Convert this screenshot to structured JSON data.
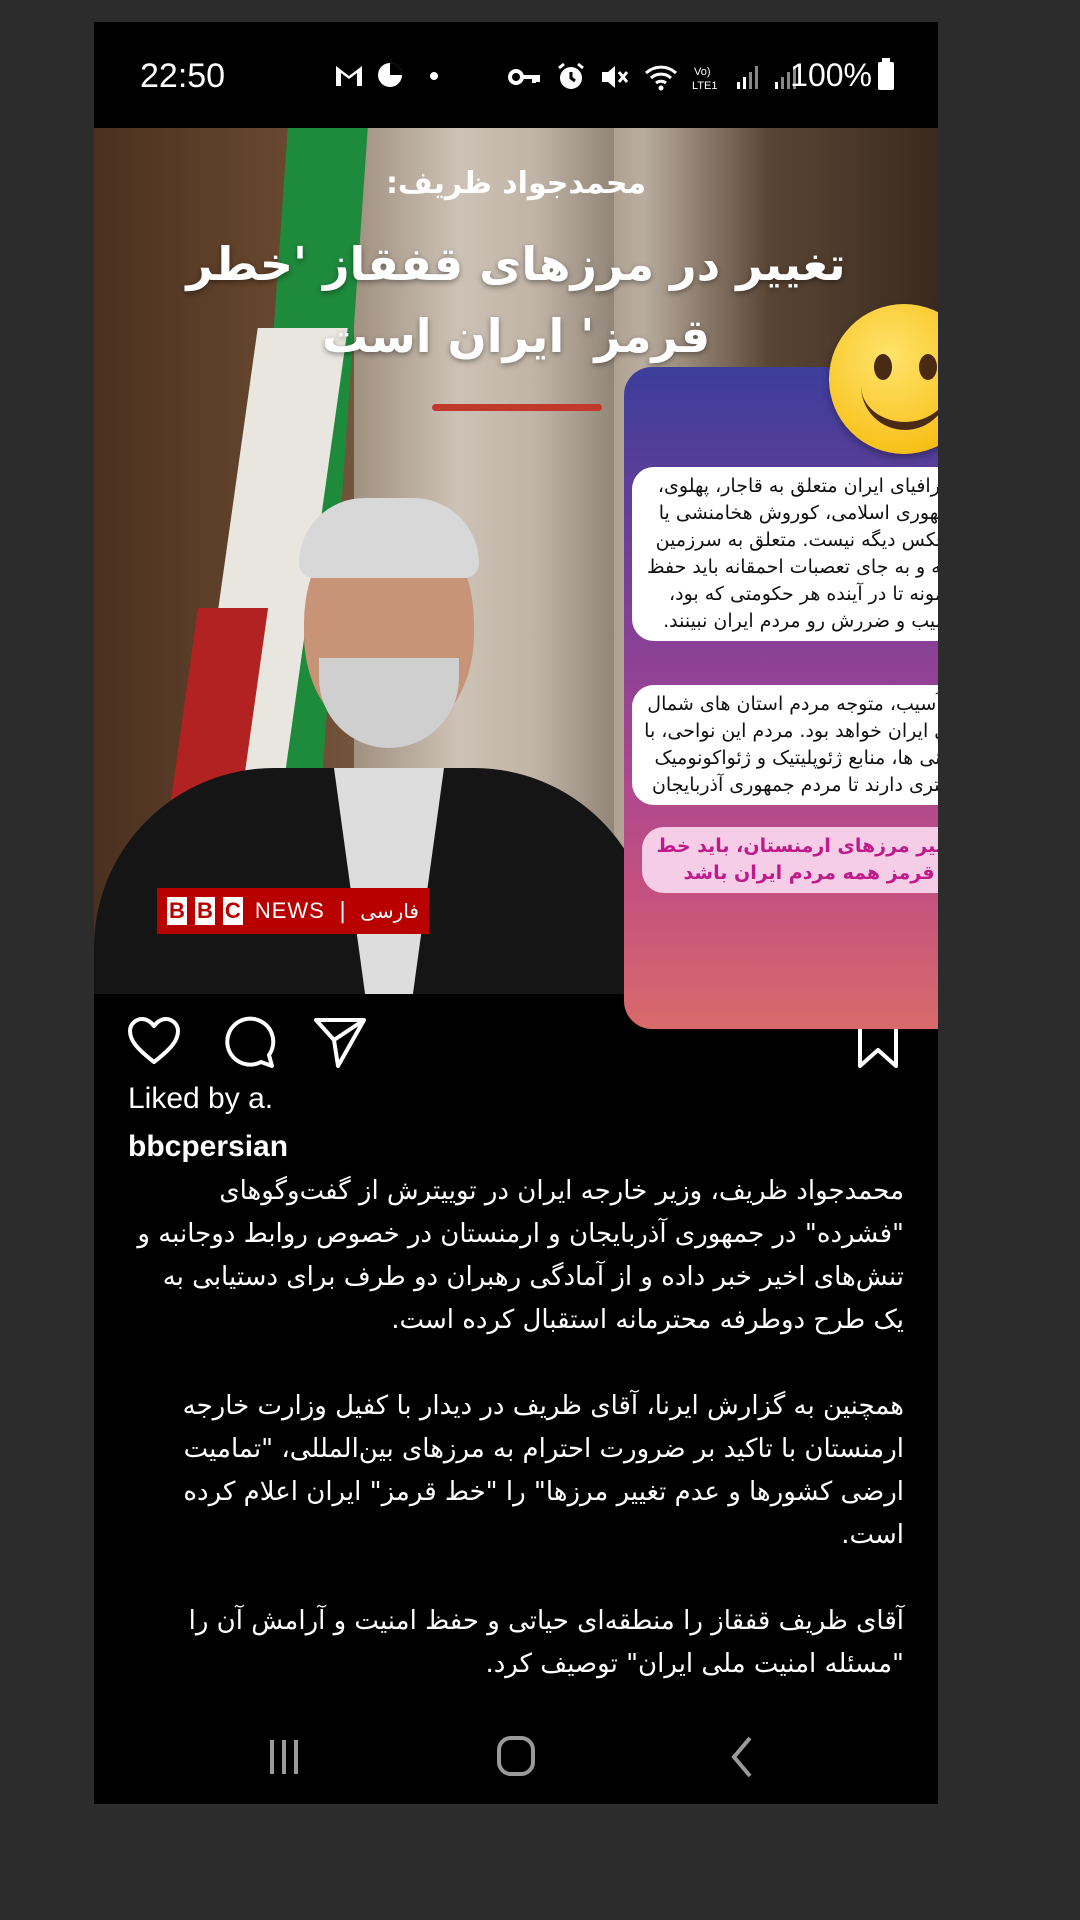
{
  "status_bar": {
    "time": "22:50",
    "battery": "100%",
    "left_icons": [
      "gmail-icon",
      "app-icon",
      "dot-icon"
    ],
    "right_icons": [
      "key-icon",
      "alarm-icon",
      "mute-icon",
      "wifi-icon",
      "volte-icon",
      "signal-icon",
      "signal-icon"
    ]
  },
  "post": {
    "image": {
      "subtitle": "محمدجواد ظریف:",
      "headline": "تغییر در مرزهای قفقاز 'خطر قرمز' ایران است",
      "logo": {
        "bbc": [
          "B",
          "B",
          "C"
        ],
        "news": "NEWS",
        "separator": "|",
        "lang": "فارسی"
      }
    },
    "sticker": {
      "bubble1": "جغرافیای ایران متعلق به قاجار، پهلوی، جمهوری اسلامی، کوروش هخامنشی یا هیچکس دیگه نیست. متعلق به سرزمین ایرانه و به جای تعصبات احمقانه باید حفظ بمونه تا در آینده هر حکومتی که بود، آسیب و ضررش رو مردم ایران نبینند.",
      "bubble2": "این آسیب، متوجه مردم استان های شمال غربی ایران خواهد بود. مردم این نواحی، با ارمنی ها، منابع ژئوپلیتیک و ژئواکونومیک بیشتری دارند تا مردم جمهوری آذربایجان",
      "bubble3": "تغییر مرزهای ارمنستان، باید خط قرمز همه مردم ایران باشد"
    },
    "liked_by": "Liked by a.",
    "username": "bbcpersian",
    "caption": [
      "محمدجواد ظریف، وزیر خارجه ایران در توییترش از گفت‌وگوهای \"فشرده\" در جمهوری آذربایجان و ارمنستان در خصوص روابط دوجانبه و تنش‌های اخیر خبر داده و از آمادگی رهبران دو طرف برای دستیابی به یک طرح دوطرفه محترمانه استقبال کرده است.",
      "همچنین به گزارش ایرنا، آقای ظریف در دیدار با کفیل وزارت خارجه ارمنستان با تاکید بر ضرورت احترام به مرزهای بین‌المللی، \"تمامیت ارضی کشورها و عدم تغییر مرزها\" را \"خط قرمز\" ایران اعلام کرده است.",
      "آقای ظریف قفقاز را منطقه‌ای حیاتی و حفظ امنیت و آرامش آن را \"مسئله امنیت ملی ایران\" توصیف کرد."
    ]
  },
  "colors": {
    "background": "#2c2c2c",
    "screen": "#000000",
    "bbc_red": "#b80000",
    "sticker_pink_text": "#c01a8a"
  }
}
